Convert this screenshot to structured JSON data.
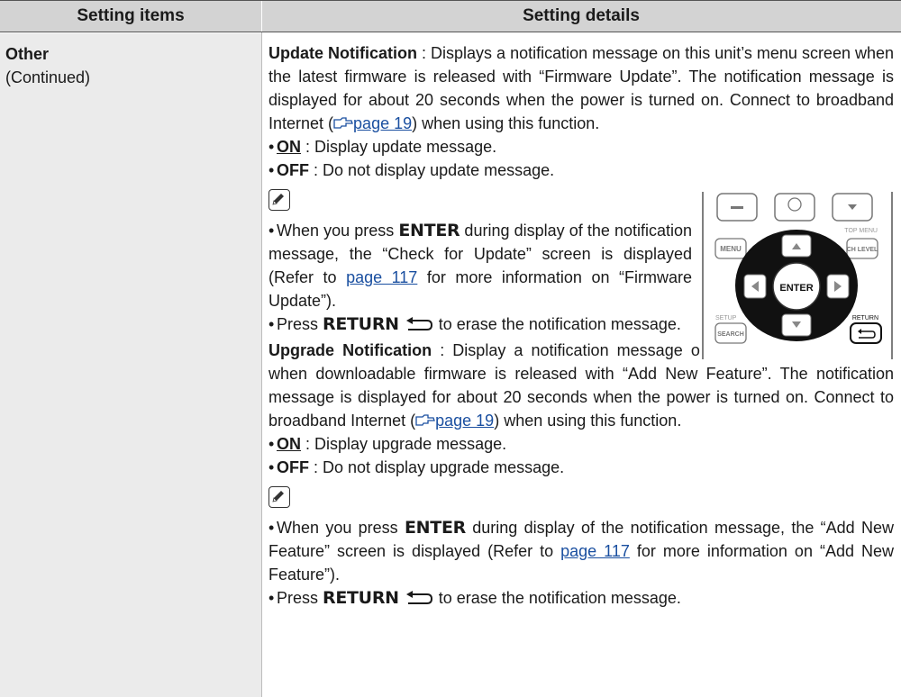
{
  "header": {
    "col1": "Setting items",
    "col2": "Setting details"
  },
  "item": {
    "name": "Other",
    "sub": "(Continued)"
  },
  "update": {
    "term": "Update Notification",
    "desc_a": " : Displays a notification message on this unit’s menu screen when the latest firmware is released with “Firmware Update”. The notification message is displayed for about 20 seconds when the power is turned on. Connect to broadband Internet (",
    "desc_link": "page 19",
    "desc_b": ") when using this function.",
    "on_key": "ON",
    "on_desc": " : Display update message.",
    "off_key": "OFF",
    "off_desc": " : Do not display update message.",
    "n1_a": "When you press ",
    "n1_key": "ENTER",
    "n1_b": " during display of the notification message, the “Check for Update” screen is displayed (Refer to ",
    "n1_link": "page 117",
    "n1_c": " for more information on “Firmware Update”).",
    "n2_a": "Press ",
    "n2_key": "RETURN",
    "n2_b": " to erase the notification message."
  },
  "remote": {
    "enter": "ENTER",
    "menu": "MENU",
    "top_menu": "TOP MENU",
    "ch_level": "CH LEVEL",
    "setup": "SETUP",
    "search": "SEARCH",
    "return": "RETURN"
  },
  "upgrade": {
    "term": "Upgrade Notification",
    "desc_a": " : Display a notification message on this unit’s menu screen when downloadable firmware is released with “Add New Feature”. The notification message is displayed for about 20 seconds when the power is turned on. Connect to broadband Internet (",
    "desc_link": "page 19",
    "desc_b": ") when using this function.",
    "on_key": "ON",
    "on_desc": " : Display upgrade message.",
    "off_key": "OFF",
    "off_desc": " : Do not display upgrade message.",
    "n1_a": "When you press ",
    "n1_key": "ENTER",
    "n1_b": " during display of the notification message, the “Add New Feature” screen is displayed (Refer to ",
    "n1_link": "page 117",
    "n1_c": " for more information on “Add New Feature”).",
    "n2_a": "Press ",
    "n2_key": "RETURN",
    "n2_b": " to erase the notification message."
  }
}
